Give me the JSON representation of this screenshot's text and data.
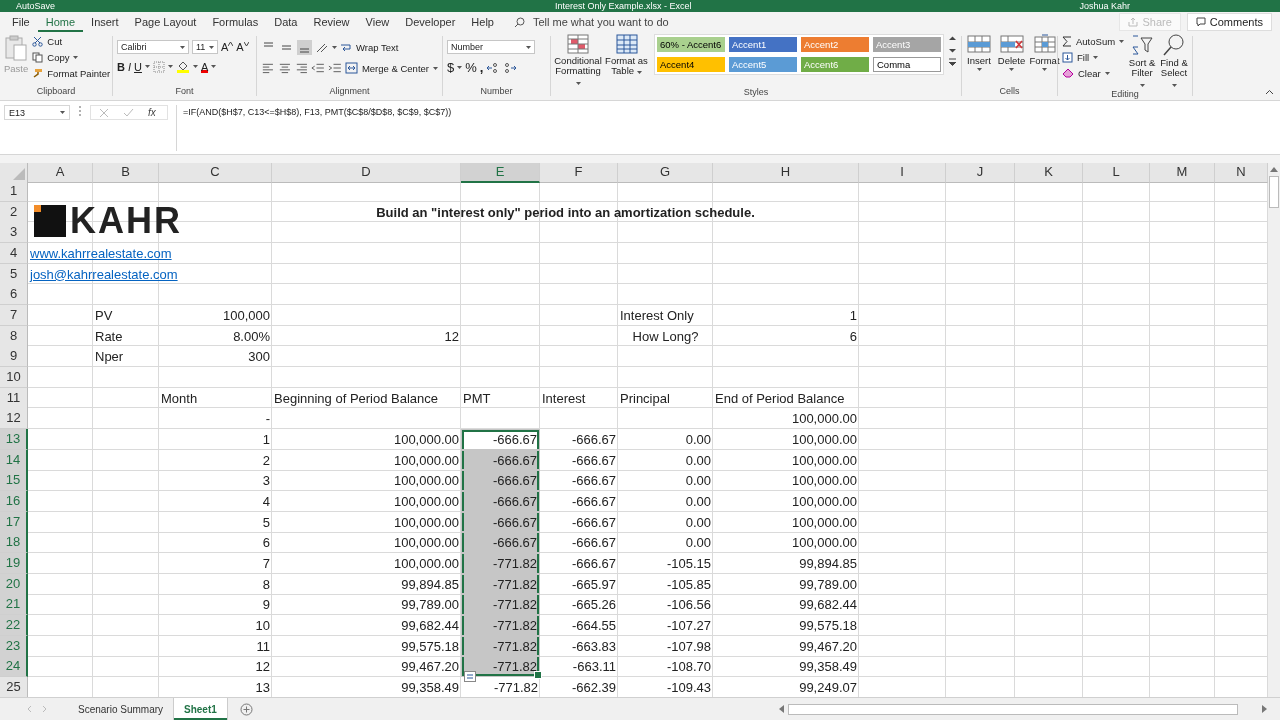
{
  "title_bar": {
    "autosave": "AutoSave",
    "title": "Interest Only Example.xlsx - Excel",
    "user": "Joshua Kahr"
  },
  "menu_tabs": [
    {
      "label": "File",
      "selected": false
    },
    {
      "label": "Home",
      "selected": true
    },
    {
      "label": "Insert",
      "selected": false
    },
    {
      "label": "Page Layout",
      "selected": false
    },
    {
      "label": "Formulas",
      "selected": false
    },
    {
      "label": "Data",
      "selected": false
    },
    {
      "label": "Review",
      "selected": false
    },
    {
      "label": "View",
      "selected": false
    },
    {
      "label": "Developer",
      "selected": false
    },
    {
      "label": "Help",
      "selected": false
    }
  ],
  "tell_me": {
    "placeholder": "Tell me what you want to do"
  },
  "share": {
    "label": "Share",
    "disabled": true
  },
  "comments": "Comments",
  "ribbon": {
    "clipboard": {
      "label": "Clipboard",
      "paste": "Paste",
      "cut": "Cut",
      "copy": "Copy",
      "format_painter": "Format Painter"
    },
    "font": {
      "label": "Font",
      "family": "Calibri",
      "size": "11",
      "grow": "A",
      "shrink": "A",
      "bold": "B",
      "italic": "I",
      "underline": "U",
      "font_color": "A"
    },
    "alignment": {
      "label": "Alignment",
      "vertical": [
        {
          "selected": false
        },
        {
          "selected": false
        },
        {
          "selected": true
        }
      ],
      "wrap": "Wrap Text",
      "merge": "Merge & Center"
    },
    "number": {
      "label": "Number",
      "format": "Number",
      "currency": "$",
      "percent": "%",
      "comma": ","
    },
    "styles": {
      "label": "Styles",
      "conditional": "Conditional Formatting",
      "format_table": "Format as Table",
      "chips": [
        {
          "label": "60% - Accent6",
          "color": "#a9d08e"
        },
        {
          "label": "Accent1",
          "color": "#4472c4"
        },
        {
          "label": "Accent2",
          "color": "#ed7d31"
        },
        {
          "label": "Accent3",
          "color": "#a5a5a5"
        },
        {
          "label": "Accent4",
          "color": "#ffc000"
        },
        {
          "label": "Accent5",
          "color": "#5b9bd5"
        },
        {
          "label": "Accent6",
          "color": "#70ad47"
        },
        {
          "label": "Comma",
          "color": "#ffffff"
        }
      ]
    },
    "cells": {
      "label": "Cells",
      "insert": "Insert",
      "delete": "Delete",
      "format": "Format"
    },
    "editing": {
      "label": "Editing",
      "autosum": "AutoSum",
      "fill": "Fill",
      "clear": "Clear",
      "sort": "Sort & Filter",
      "find": "Find & Select"
    }
  },
  "formula_bar": {
    "name_box": "E13",
    "function_label": "fx",
    "formula": "=IF(AND($H$7, C13<=$H$8), F13, PMT($C$8/$D$8, $C$9, $C$7))"
  },
  "sheet": {
    "columns": [
      {
        "label": "A",
        "selected": false
      },
      {
        "label": "B",
        "selected": false
      },
      {
        "label": "C",
        "selected": false
      },
      {
        "label": "D",
        "selected": false
      },
      {
        "label": "E",
        "selected": true
      },
      {
        "label": "F",
        "selected": false
      },
      {
        "label": "G",
        "selected": false
      },
      {
        "label": "H",
        "selected": false
      },
      {
        "label": "I",
        "selected": false
      },
      {
        "label": "J",
        "selected": false
      },
      {
        "label": "K",
        "selected": false
      },
      {
        "label": "L",
        "selected": false
      },
      {
        "label": "M",
        "selected": false
      },
      {
        "label": "N",
        "selected": false
      }
    ],
    "rows": [
      {
        "label": "1",
        "selected": false
      },
      {
        "label": "2",
        "selected": false,
        "cells": [
          {
            "kind": "logo",
            "text": "KAHR"
          },
          {
            "kind": "title",
            "text": "Build an \"interest only\" period into an amortization schedule."
          }
        ]
      },
      {
        "label": "3",
        "selected": false
      },
      {
        "label": "4",
        "selected": false,
        "cells": [
          {
            "kind": "link",
            "text": "www.kahrrealestate.com"
          }
        ]
      },
      {
        "label": "5",
        "selected": false,
        "cells": [
          {
            "kind": "link",
            "text": "josh@kahrrealestate.com"
          }
        ]
      },
      {
        "label": "6",
        "selected": false
      },
      {
        "label": "7",
        "selected": false,
        "cells": [
          {
            "kind": "blank"
          },
          {
            "kind": "text",
            "text": "PV"
          },
          {
            "kind": "number",
            "text": "100,000"
          },
          {
            "kind": "blank"
          },
          {
            "kind": "blank"
          },
          {
            "kind": "blank"
          },
          {
            "kind": "text",
            "text": "Interest Only"
          },
          {
            "kind": "number",
            "text": "1"
          }
        ]
      },
      {
        "label": "8",
        "selected": false,
        "cells": [
          {
            "kind": "blank"
          },
          {
            "kind": "text",
            "text": "Rate"
          },
          {
            "kind": "number",
            "text": "8.00%"
          },
          {
            "kind": "number",
            "text": "12"
          },
          {
            "kind": "blank"
          },
          {
            "kind": "blank"
          },
          {
            "kind": "centered",
            "text": "How Long?"
          },
          {
            "kind": "number",
            "text": "6"
          }
        ]
      },
      {
        "label": "9",
        "selected": false,
        "cells": [
          {
            "kind": "blank"
          },
          {
            "kind": "text",
            "text": "Nper"
          },
          {
            "kind": "number",
            "text": "300"
          }
        ]
      },
      {
        "label": "10",
        "selected": false
      },
      {
        "label": "11",
        "selected": false,
        "cells": [
          {
            "kind": "blank"
          },
          {
            "kind": "blank"
          },
          {
            "kind": "text",
            "text": "Month"
          },
          {
            "kind": "text",
            "text": "Beginning of Period Balance"
          },
          {
            "kind": "text",
            "text": "PMT"
          },
          {
            "kind": "text",
            "text": "Interest"
          },
          {
            "kind": "text",
            "text": "Principal"
          },
          {
            "kind": "text",
            "text": "End of Period Balance"
          }
        ]
      },
      {
        "label": "12",
        "selected": false,
        "cells": [
          {
            "kind": "blank"
          },
          {
            "kind": "blank"
          },
          {
            "kind": "number",
            "text": "-"
          },
          {
            "kind": "blank"
          },
          {
            "kind": "blank"
          },
          {
            "kind": "blank"
          },
          {
            "kind": "blank"
          },
          {
            "kind": "number",
            "text": "100,000.00"
          }
        ]
      },
      {
        "label": "13",
        "selected": true,
        "cells": [
          {
            "kind": "blank"
          },
          {
            "kind": "blank"
          },
          {
            "kind": "number",
            "text": "1"
          },
          {
            "kind": "number",
            "text": "100,000.00"
          },
          {
            "kind": "number",
            "text": "-666.67"
          },
          {
            "kind": "number",
            "text": "-666.67"
          },
          {
            "kind": "number",
            "text": "0.00"
          },
          {
            "kind": "number",
            "text": "100,000.00"
          }
        ]
      },
      {
        "label": "14",
        "selected": true,
        "cells": [
          {
            "kind": "blank"
          },
          {
            "kind": "blank"
          },
          {
            "kind": "number",
            "text": "2"
          },
          {
            "kind": "number",
            "text": "100,000.00"
          },
          {
            "kind": "number",
            "text": "-666.67"
          },
          {
            "kind": "number",
            "text": "-666.67"
          },
          {
            "kind": "number",
            "text": "0.00"
          },
          {
            "kind": "number",
            "text": "100,000.00"
          }
        ]
      },
      {
        "label": "15",
        "selected": true,
        "cells": [
          {
            "kind": "blank"
          },
          {
            "kind": "blank"
          },
          {
            "kind": "number",
            "text": "3"
          },
          {
            "kind": "number",
            "text": "100,000.00"
          },
          {
            "kind": "number",
            "text": "-666.67"
          },
          {
            "kind": "number",
            "text": "-666.67"
          },
          {
            "kind": "number",
            "text": "0.00"
          },
          {
            "kind": "number",
            "text": "100,000.00"
          }
        ]
      },
      {
        "label": "16",
        "selected": true,
        "cells": [
          {
            "kind": "blank"
          },
          {
            "kind": "blank"
          },
          {
            "kind": "number",
            "text": "4"
          },
          {
            "kind": "number",
            "text": "100,000.00"
          },
          {
            "kind": "number",
            "text": "-666.67"
          },
          {
            "kind": "number",
            "text": "-666.67"
          },
          {
            "kind": "number",
            "text": "0.00"
          },
          {
            "kind": "number",
            "text": "100,000.00"
          }
        ]
      },
      {
        "label": "17",
        "selected": true,
        "cells": [
          {
            "kind": "blank"
          },
          {
            "kind": "blank"
          },
          {
            "kind": "number",
            "text": "5"
          },
          {
            "kind": "number",
            "text": "100,000.00"
          },
          {
            "kind": "number",
            "text": "-666.67"
          },
          {
            "kind": "number",
            "text": "-666.67"
          },
          {
            "kind": "number",
            "text": "0.00"
          },
          {
            "kind": "number",
            "text": "100,000.00"
          }
        ]
      },
      {
        "label": "18",
        "selected": true,
        "cells": [
          {
            "kind": "blank"
          },
          {
            "kind": "blank"
          },
          {
            "kind": "number",
            "text": "6"
          },
          {
            "kind": "number",
            "text": "100,000.00"
          },
          {
            "kind": "number",
            "text": "-666.67"
          },
          {
            "kind": "number",
            "text": "-666.67"
          },
          {
            "kind": "number",
            "text": "0.00"
          },
          {
            "kind": "number",
            "text": "100,000.00"
          }
        ]
      },
      {
        "label": "19",
        "selected": true,
        "cells": [
          {
            "kind": "blank"
          },
          {
            "kind": "blank"
          },
          {
            "kind": "number",
            "text": "7"
          },
          {
            "kind": "number",
            "text": "100,000.00"
          },
          {
            "kind": "number",
            "text": "-771.82"
          },
          {
            "kind": "number",
            "text": "-666.67"
          },
          {
            "kind": "number",
            "text": "-105.15"
          },
          {
            "kind": "number",
            "text": "99,894.85"
          }
        ]
      },
      {
        "label": "20",
        "selected": true,
        "cells": [
          {
            "kind": "blank"
          },
          {
            "kind": "blank"
          },
          {
            "kind": "number",
            "text": "8"
          },
          {
            "kind": "number",
            "text": "99,894.85"
          },
          {
            "kind": "number",
            "text": "-771.82"
          },
          {
            "kind": "number",
            "text": "-665.97"
          },
          {
            "kind": "number",
            "text": "-105.85"
          },
          {
            "kind": "number",
            "text": "99,789.00"
          }
        ]
      },
      {
        "label": "21",
        "selected": true,
        "cells": [
          {
            "kind": "blank"
          },
          {
            "kind": "blank"
          },
          {
            "kind": "number",
            "text": "9"
          },
          {
            "kind": "number",
            "text": "99,789.00"
          },
          {
            "kind": "number",
            "text": "-771.82"
          },
          {
            "kind": "number",
            "text": "-665.26"
          },
          {
            "kind": "number",
            "text": "-106.56"
          },
          {
            "kind": "number",
            "text": "99,682.44"
          }
        ]
      },
      {
        "label": "22",
        "selected": true,
        "cells": [
          {
            "kind": "blank"
          },
          {
            "kind": "blank"
          },
          {
            "kind": "number",
            "text": "10"
          },
          {
            "kind": "number",
            "text": "99,682.44"
          },
          {
            "kind": "number",
            "text": "-771.82"
          },
          {
            "kind": "number",
            "text": "-664.55"
          },
          {
            "kind": "number",
            "text": "-107.27"
          },
          {
            "kind": "number",
            "text": "99,575.18"
          }
        ]
      },
      {
        "label": "23",
        "selected": true,
        "cells": [
          {
            "kind": "blank"
          },
          {
            "kind": "blank"
          },
          {
            "kind": "number",
            "text": "11"
          },
          {
            "kind": "number",
            "text": "99,575.18"
          },
          {
            "kind": "number",
            "text": "-771.82"
          },
          {
            "kind": "number",
            "text": "-663.83"
          },
          {
            "kind": "number",
            "text": "-107.98"
          },
          {
            "kind": "number",
            "text": "99,467.20"
          }
        ]
      },
      {
        "label": "24",
        "selected": true,
        "cells": [
          {
            "kind": "blank"
          },
          {
            "kind": "blank"
          },
          {
            "kind": "number",
            "text": "12"
          },
          {
            "kind": "number",
            "text": "99,467.20"
          },
          {
            "kind": "number",
            "text": "-771.82"
          },
          {
            "kind": "number",
            "text": "-663.11"
          },
          {
            "kind": "number",
            "text": "-108.70"
          },
          {
            "kind": "number",
            "text": "99,358.49"
          }
        ]
      },
      {
        "label": "25",
        "selected": false,
        "cells": [
          {
            "kind": "blank"
          },
          {
            "kind": "blank"
          },
          {
            "kind": "number",
            "text": "13"
          },
          {
            "kind": "number",
            "text": "99,358.49"
          },
          {
            "kind": "number",
            "text": "-771.82"
          },
          {
            "kind": "number",
            "text": "-662.39"
          },
          {
            "kind": "number",
            "text": "-109.43"
          },
          {
            "kind": "number",
            "text": "99,249.07"
          }
        ]
      }
    ]
  },
  "sheet_tabs": [
    {
      "label": "Scenario Summary",
      "selected": false
    },
    {
      "label": "Sheet1",
      "selected": true
    }
  ]
}
